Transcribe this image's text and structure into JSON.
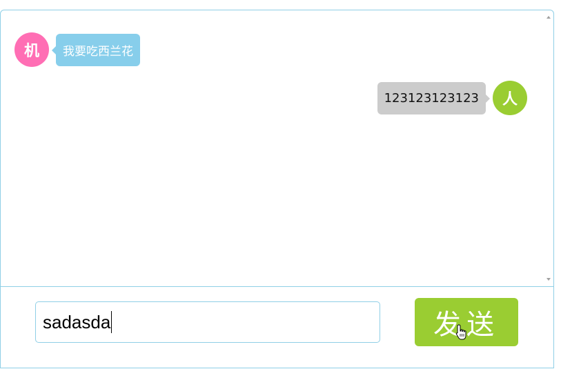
{
  "colors": {
    "border": "#8fcfe6",
    "robot_avatar": "#ff6eb4",
    "user_avatar": "#9acd32",
    "robot_bubble": "#87ceeb",
    "user_bubble": "#cccccc",
    "send_button": "#9acd32"
  },
  "messages": [
    {
      "sender": "robot",
      "avatar_text": "机",
      "text": "我要吃西兰花"
    },
    {
      "sender": "user",
      "avatar_text": "人",
      "text": "123123123123"
    }
  ],
  "input": {
    "value": "sadasda"
  },
  "send_button": {
    "label": "发送"
  },
  "icons": {
    "cursor": "hand-pointer-icon",
    "scroll_up": "arrow-up-icon",
    "scroll_down": "arrow-down-icon"
  }
}
